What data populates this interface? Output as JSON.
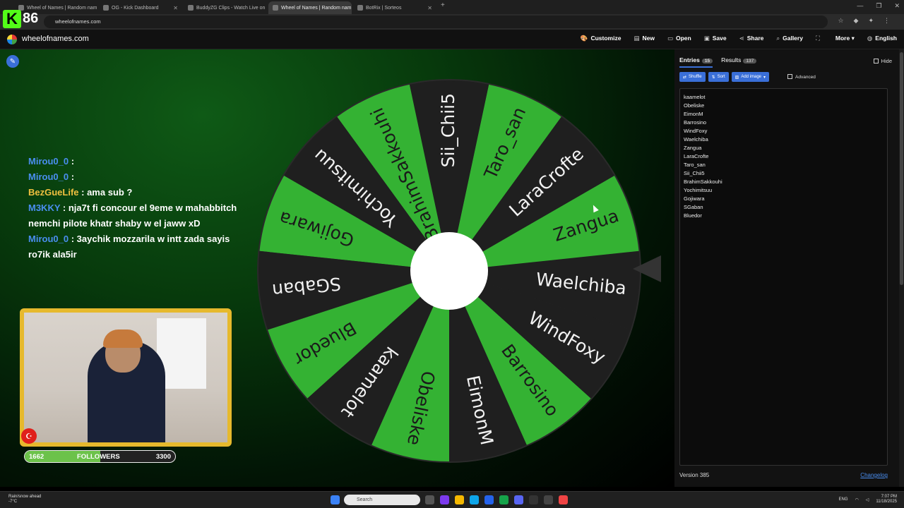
{
  "browser": {
    "tabs": [
      {
        "label": "Wheel of Names | Random nam",
        "active": false
      },
      {
        "label": "OG - Kick Dashboard",
        "active": false
      },
      {
        "label": "BuddyZG Clips - Watch Live on",
        "active": false
      },
      {
        "label": "Wheel of Names | Random nam",
        "active": true
      },
      {
        "label": "BotRix | Sorteos",
        "active": false
      }
    ],
    "new_tab": "+",
    "url": "wheelofnames.com",
    "kick_logo": "K",
    "kick_count": "86"
  },
  "site": {
    "title": "wheelofnames.com",
    "menu": [
      "Customize",
      "New",
      "Open",
      "Save",
      "Share",
      "Gallery",
      "More",
      "English"
    ]
  },
  "chat": [
    {
      "user": "Mirou0_0",
      "text": ":",
      "user_color": "#4a8ef0"
    },
    {
      "user": "Mirou0_0",
      "text": ":",
      "user_color": "#4a8ef0"
    },
    {
      "user": "BezGueLife",
      "text": ": ama sub ?",
      "user_color": "#f0c040"
    },
    {
      "user": "M3KKY",
      "text": ": nja7t fi concour el 9eme w mahabbitch nemchi pilote khatr shaby w el jaww xD",
      "user_color": "#4a8ef0"
    },
    {
      "user": "Mirou0_0",
      "text": ": 3aychik mozzarila w intt zada sayis ro7ik ala5ir",
      "user_color": "#4a8ef0"
    }
  ],
  "followers": {
    "current": "1662",
    "label": "FOLLOWERS",
    "goal": "3300",
    "fraction": 0.5036
  },
  "wheel": {
    "segments": [
      "Waelchiba",
      "Zangua",
      "LaraCrofte",
      "Taro_san",
      "Sii_Chii5",
      "BrahimSakkouhi",
      "Yochimitsuu",
      "Gojiwara",
      "SGaban",
      "Bluedor",
      "kaamelot",
      "Obeliske",
      "EimonM",
      "Barrosino",
      "WindFoxy"
    ],
    "colors": {
      "green": "#34b233",
      "dark": "#1f1f1f"
    }
  },
  "panel": {
    "tab_entries": "Entries",
    "entries_count": "15",
    "tab_results": "Results",
    "results_count": "137",
    "hide_label": "Hide",
    "shuffle_label": "Shuffle",
    "sort_label": "Sort",
    "add_image_label": "Add image",
    "advanced_label": "Advanced",
    "entries": [
      "kaamelot",
      "Obeliske",
      "EimonM",
      "Barrosino",
      "WindFoxy",
      "Waelchiba",
      "Zangua",
      "LaraCrofte",
      "Taro_san",
      "Sii_Chii5",
      "BrahimSakkouhi",
      "Yochimitsuu",
      "Gojiwara",
      "SGaban",
      "Bluedor"
    ],
    "version": "Version 385",
    "changelog": "Changelog"
  },
  "taskbar": {
    "weather_line1": "Rain/snow ahead",
    "weather_line2": "-7°C",
    "search_placeholder": "Search",
    "lang": "ENG",
    "time": "7:07 PM",
    "date": "11/18/2025"
  }
}
